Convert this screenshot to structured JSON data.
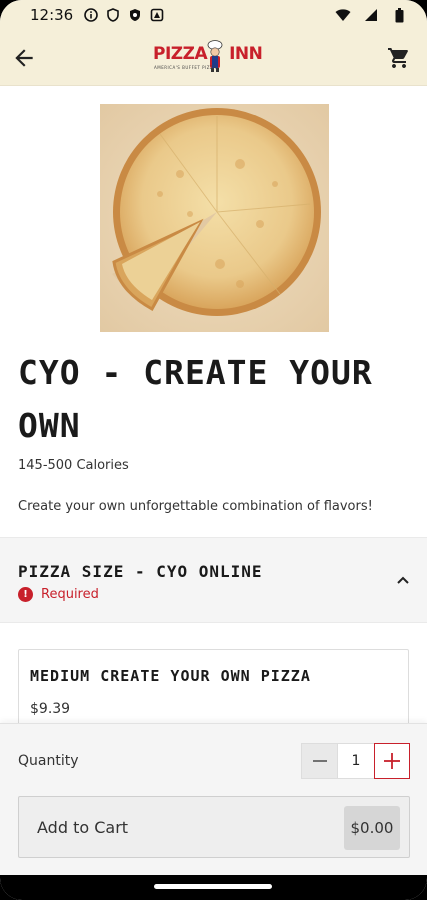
{
  "status_bar": {
    "time": "12:36",
    "icons": [
      "circle-i-icon",
      "shield-icon",
      "security-badge-icon",
      "notification-icon",
      "wifi-icon",
      "signal-icon",
      "battery-icon"
    ]
  },
  "header": {
    "back_icon": "arrow-left-icon",
    "logo_text_1": "PIZZA",
    "logo_text_2": "INN",
    "logo_tagline": "AMERICA'S BUFFET PIZZA",
    "cart_icon": "cart-icon",
    "bg_color": "#f5efd9"
  },
  "product": {
    "image": "pizza-photo",
    "title": "CYO - CREATE YOUR OWN",
    "calories": "145-500 Calories",
    "description": "Create your own unforgettable combination of flavors!"
  },
  "size_section": {
    "title": "PIZZA SIZE - CYO ONLINE",
    "required_label": "Required",
    "expanded": true,
    "options": [
      {
        "name": "MEDIUM CREATE YOUR OWN PIZZA",
        "price": "$9.39"
      }
    ]
  },
  "bottom_panel": {
    "quantity_label": "Quantity",
    "quantity_value": "1",
    "minus_symbol": "−",
    "plus_symbol": "+",
    "add_to_cart_label": "Add to Cart",
    "add_to_cart_price": "$0.00"
  },
  "colors": {
    "accent": "#c8202b",
    "header_bg": "#f5efd9",
    "panel_bg": "#f5f5f5"
  }
}
